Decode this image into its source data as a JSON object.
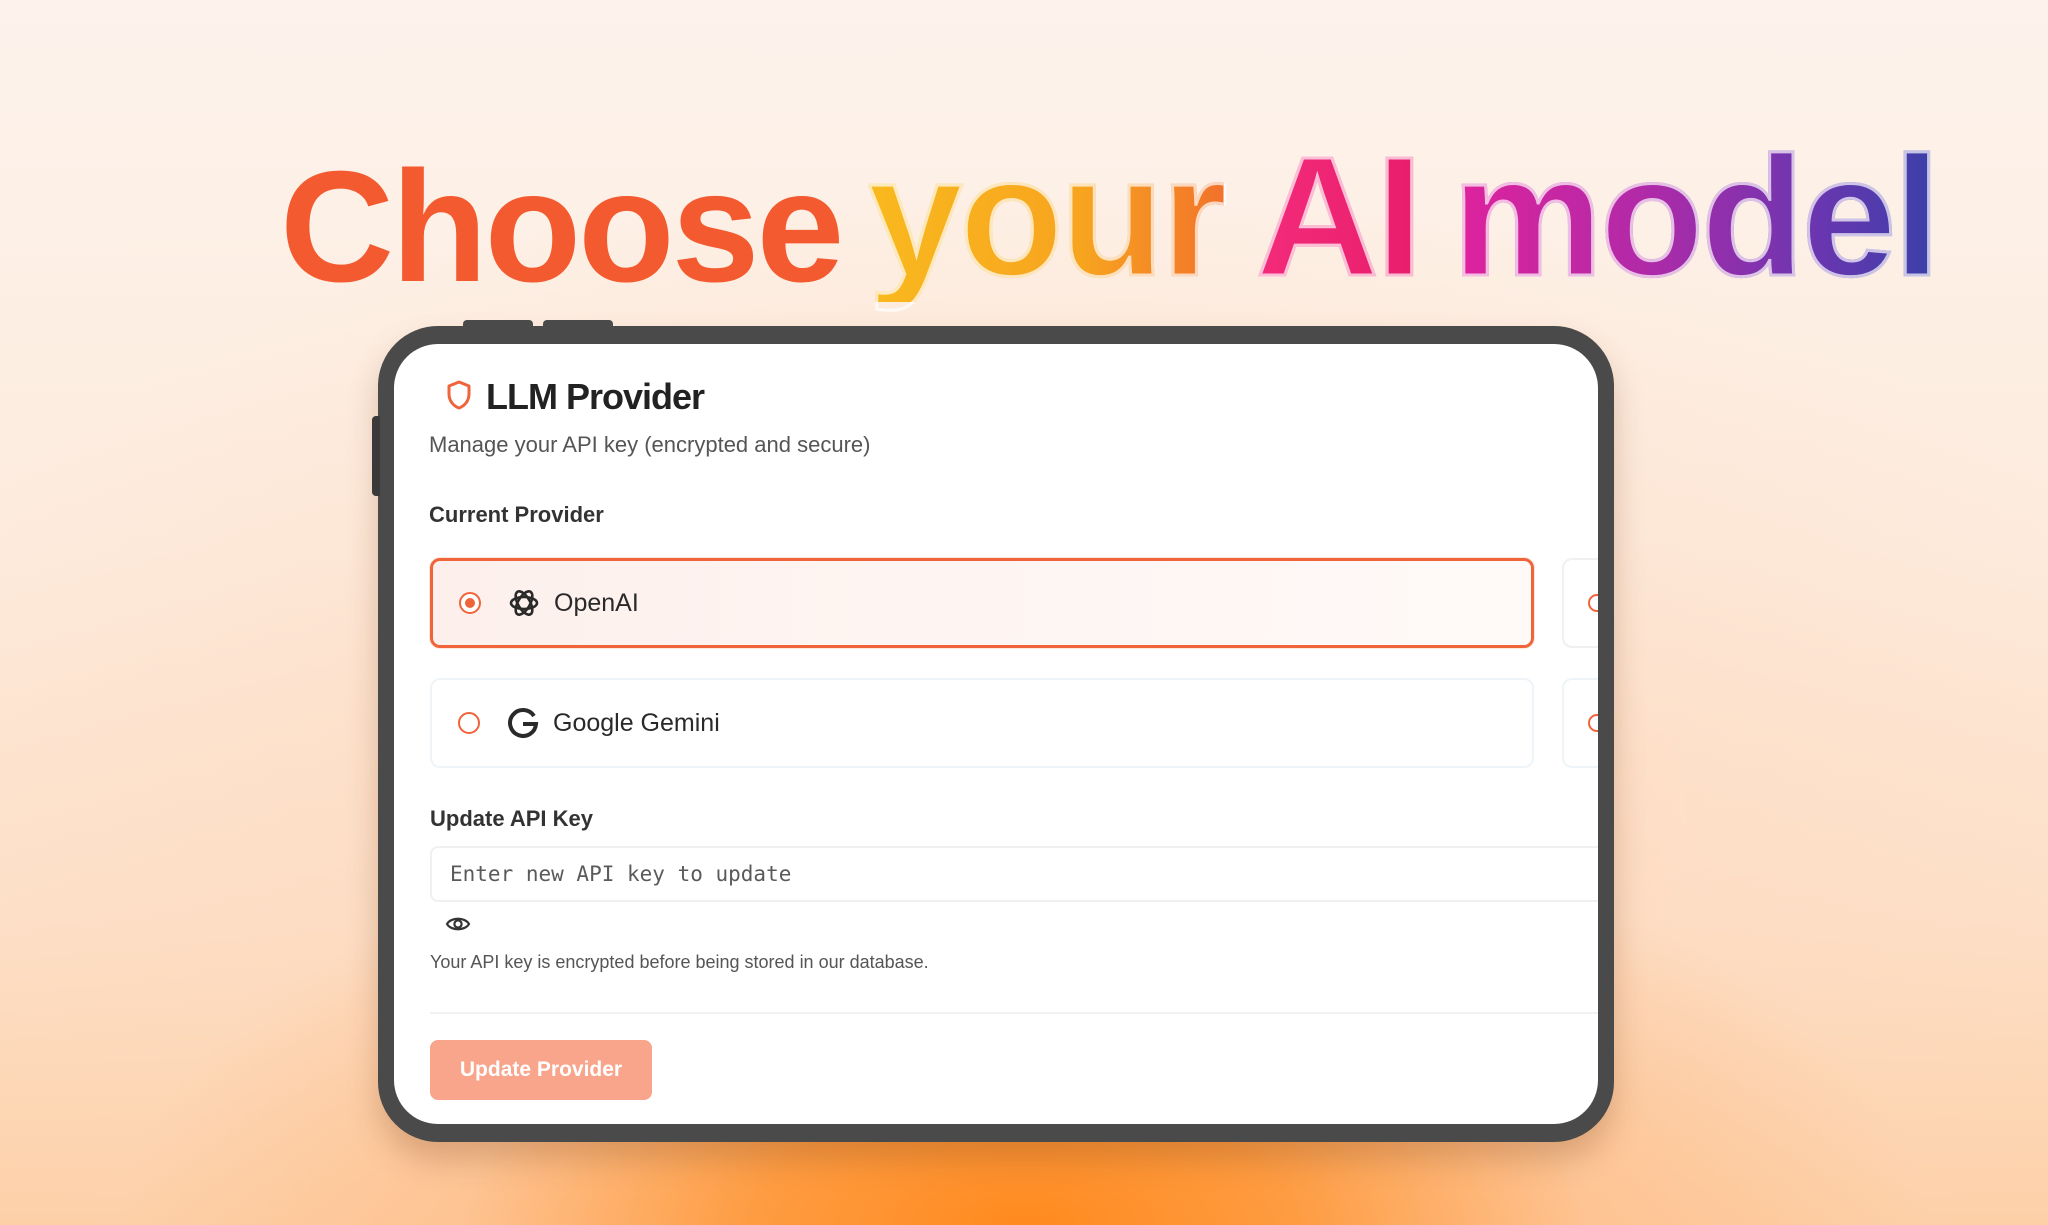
{
  "headline": {
    "word1": "Choose",
    "word2": "your",
    "word3": "AI",
    "word4": "model"
  },
  "card": {
    "icon": "shield-icon",
    "title": "LLM Provider",
    "subtitle": "Manage your API key (encrypted and secure)"
  },
  "providers": {
    "label": "Current Provider",
    "selected": "OpenAI",
    "options": [
      {
        "label": "OpenAI",
        "icon": "openai-logo-icon",
        "selected": true
      },
      {
        "label": "Google Gemini",
        "icon": "google-g-icon",
        "selected": false
      }
    ]
  },
  "api_key": {
    "label": "Update API Key",
    "value": "",
    "placeholder": "Enter new API key to update",
    "toggle_icon": "eye-icon",
    "hint": "Your API key is encrypted before being stored in our database."
  },
  "submit": {
    "label": "Update Provider"
  },
  "colors": {
    "accent": "#f0643a",
    "button_disabled": "#f8a58c",
    "headline_choose": "#f45a2f"
  }
}
